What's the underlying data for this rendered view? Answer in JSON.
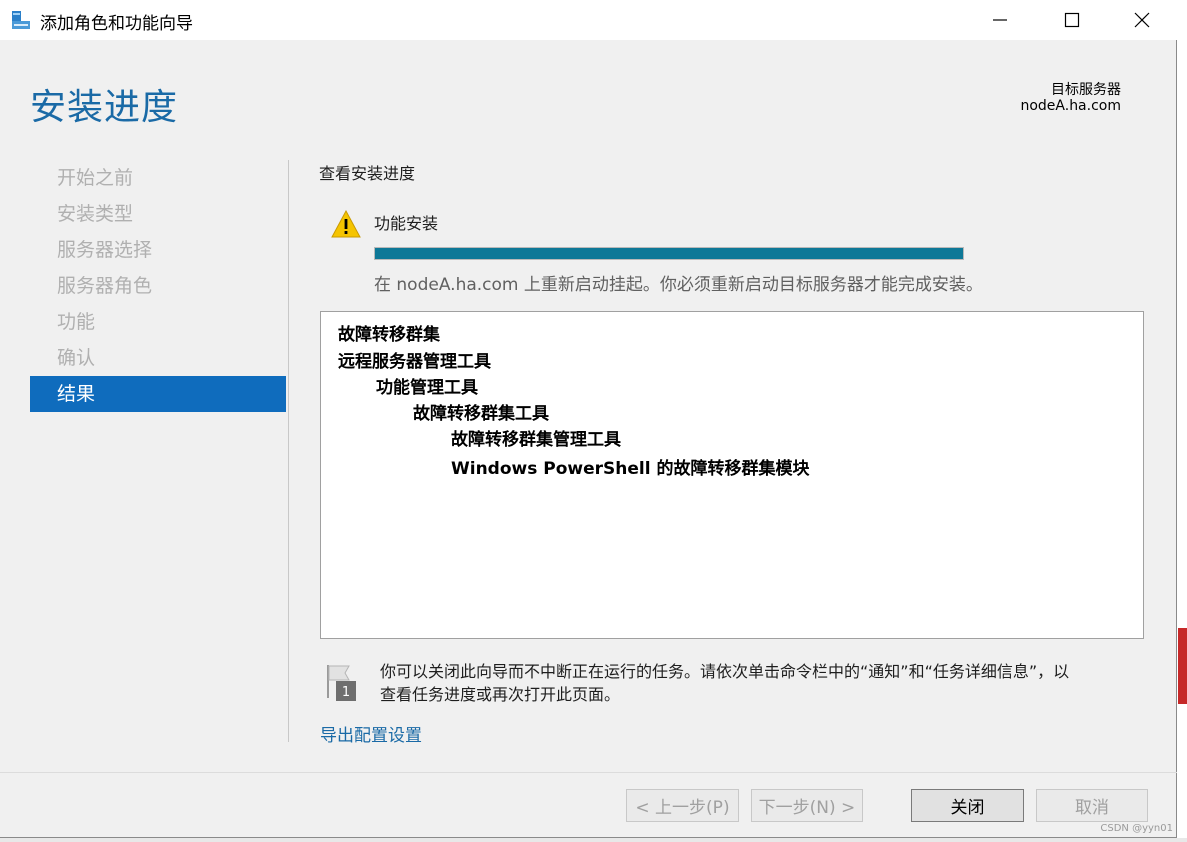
{
  "window": {
    "title": "添加角色和功能向导"
  },
  "header": {
    "page_title": "安装进度",
    "target_label": "目标服务器",
    "target_value": "nodeA.ha.com"
  },
  "nav": {
    "items": [
      {
        "label": "开始之前",
        "active": false
      },
      {
        "label": "安装类型",
        "active": false
      },
      {
        "label": "服务器选择",
        "active": false
      },
      {
        "label": "服务器角色",
        "active": false
      },
      {
        "label": "功能",
        "active": false
      },
      {
        "label": "确认",
        "active": false
      },
      {
        "label": "结果",
        "active": true
      }
    ]
  },
  "content": {
    "section_title": "查看安装进度",
    "feature_label": "功能安装",
    "progress_percent": 100,
    "status_message": "在 nodeA.ha.com 上重新启动挂起。你必须重新启动目标服务器才能完成安装。",
    "list": [
      {
        "text": "故障转移群集",
        "level": 0
      },
      {
        "text": "远程服务器管理工具",
        "level": 0
      },
      {
        "text": "功能管理工具",
        "level": 1
      },
      {
        "text": "故障转移群集工具",
        "level": 2
      },
      {
        "text": "故障转移群集管理工具",
        "level": 3
      },
      {
        "text": "Windows PowerShell 的故障转移群集模块",
        "level": 3
      }
    ],
    "info_line1": "你可以关闭此向导而不中断正在运行的任务。请依次单击命令栏中的“通知”和“任务详细信息”，以",
    "info_line2": "查看任务进度或再次打开此页面。",
    "export_link": "导出配置设置"
  },
  "footer": {
    "prev_label": "< 上一步(P)",
    "next_label": "下一步(N) >",
    "close_label": "关闭",
    "cancel_label": "取消"
  },
  "watermark": "CSDN @yyn01",
  "colors": {
    "accent": "#1a6aa6",
    "nav_active": "#0f6cbd",
    "progress": "#0e7897",
    "warning": "#f5c400"
  }
}
